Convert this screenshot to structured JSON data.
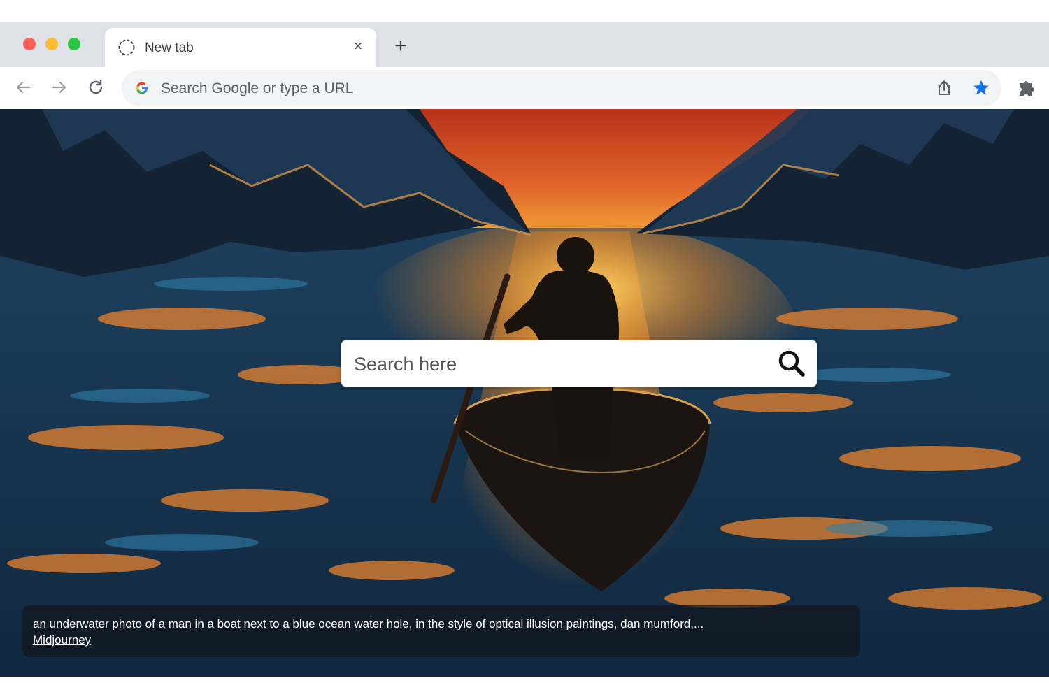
{
  "browser": {
    "tab": {
      "title": "New tab",
      "close_glyph": "×",
      "icon": "globe-icon"
    },
    "new_tab_glyph": "+",
    "toolbar": {
      "omnibox_placeholder": "Search Google or type a URL",
      "icons": [
        "back-arrow-icon",
        "forward-arrow-icon",
        "reload-icon",
        "google-g-icon",
        "share-icon",
        "star-icon",
        "puzzle-extension-icon"
      ],
      "star_color": "#1a73e8"
    }
  },
  "page": {
    "search": {
      "placeholder": "Search here",
      "icon": "magnifier-icon"
    },
    "caption": {
      "text": "an underwater photo of a man in a boat next to a blue ocean water hole, in the style of optical illusion paintings, dan mumford,...",
      "link": "Midjourney"
    },
    "colors": {
      "sky": "#e0652a",
      "water": "#1c4a6b",
      "sun": "#f6b23c"
    }
  }
}
